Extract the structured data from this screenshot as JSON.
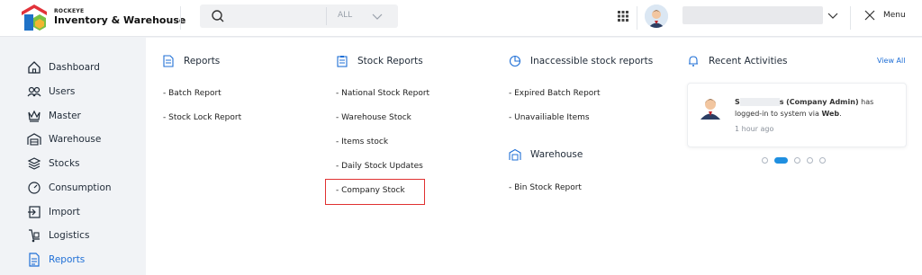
{
  "brand": {
    "small": "ROCKEYE",
    "title": "Inventory & Warehouse"
  },
  "search": {
    "placeholder": "",
    "scope": "ALL"
  },
  "header": {
    "menu_label": "Menu"
  },
  "sidebar": {
    "items": [
      {
        "label": "Dashboard",
        "icon": "home-icon"
      },
      {
        "label": "Users",
        "icon": "users-icon"
      },
      {
        "label": "Master",
        "icon": "crown-icon"
      },
      {
        "label": "Warehouse",
        "icon": "warehouse-icon"
      },
      {
        "label": "Stocks",
        "icon": "layers-icon"
      },
      {
        "label": "Consumption",
        "icon": "gauge-icon"
      },
      {
        "label": "Import",
        "icon": "import-icon"
      },
      {
        "label": "Logistics",
        "icon": "dolly-icon"
      },
      {
        "label": "Reports",
        "icon": "document-icon",
        "active": true
      }
    ]
  },
  "menu": {
    "reports": {
      "title": "Reports",
      "links": [
        "- Batch Report",
        "- Stock Lock Report"
      ]
    },
    "stock_reports": {
      "title": "Stock Reports",
      "links": [
        "- National Stock Report",
        "- Warehouse Stock",
        "- Items stock",
        "- Daily Stock Updates",
        "- Company Stock"
      ],
      "highlighted": "- Company Stock"
    },
    "inaccessible": {
      "title": "Inaccessible stock reports",
      "links": [
        "- Expired Batch Report",
        "- Unavailiable Items"
      ]
    },
    "warehouse": {
      "title": "Warehouse",
      "links": [
        "- Bin Stock Report"
      ]
    },
    "recent": {
      "title": "Recent Activities",
      "view_all": "View All",
      "activity": {
        "name_visible": "S",
        "name_suffix": "s",
        "role": "(Company Admin)",
        "text1": " has logged-in to system via ",
        "channel": "Web",
        "text2": ".",
        "time": "1 hour ago"
      },
      "carousel_active": 1,
      "carousel_count": 5
    }
  },
  "colors": {
    "accent": "#1f6fd6",
    "highlight": "#e03131",
    "dot_active": "#1f8fe0"
  }
}
